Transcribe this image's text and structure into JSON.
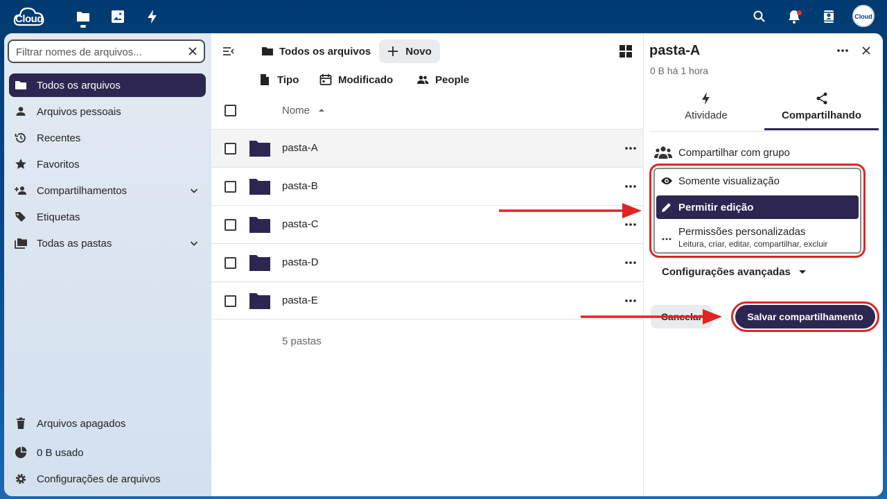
{
  "header": {
    "logo_text": "Cloud",
    "apps": [
      {
        "icon": "folder-icon",
        "name": "files-app"
      },
      {
        "icon": "image-icon",
        "name": "photos-app"
      },
      {
        "icon": "bolt-icon",
        "name": "activity-app"
      }
    ],
    "right_icons": [
      "search-icon",
      "bell-icon",
      "contacts-icon"
    ],
    "avatar_text": "Cloud",
    "brand_color": "#003a70",
    "accent_color": "#2c2651",
    "highlight_color": "#e02424"
  },
  "sidebar": {
    "filter_placeholder": "Filtrar nomes de arquivos...",
    "items": [
      {
        "label": "Todos os arquivos",
        "icon": "folder-icon",
        "active": true
      },
      {
        "label": "Arquivos pessoais",
        "icon": "person-icon"
      },
      {
        "label": "Recentes",
        "icon": "history-icon"
      },
      {
        "label": "Favoritos",
        "icon": "star-icon"
      },
      {
        "label": "Compartilhamentos",
        "icon": "share-person-icon",
        "expandable": true
      },
      {
        "label": "Etiquetas",
        "icon": "tag-icon"
      },
      {
        "label": "Todas as pastas",
        "icon": "folders-icon",
        "expandable": true
      }
    ],
    "bottom": [
      {
        "label": "Arquivos apagados",
        "icon": "trash-icon"
      },
      {
        "label": "0 B usado",
        "icon": "pie-chart-icon"
      },
      {
        "label": "Configurações de arquivos",
        "icon": "gear-icon"
      }
    ]
  },
  "main": {
    "breadcrumb": "Todos os arquivos",
    "new_button": "Novo",
    "filters": [
      {
        "label": "Tipo",
        "icon": "file-icon"
      },
      {
        "label": "Modificado",
        "icon": "calendar-icon"
      },
      {
        "label": "People",
        "icon": "people-icon"
      }
    ],
    "column_name": "Nome",
    "rows": [
      {
        "name": "pasta-A",
        "highlighted": true
      },
      {
        "name": "pasta-B"
      },
      {
        "name": "pasta-C"
      },
      {
        "name": "pasta-D"
      },
      {
        "name": "pasta-E"
      }
    ],
    "footer": "5 pastas"
  },
  "sidebar_right": {
    "title": "pasta-A",
    "subtitle": "0 B há 1 hora",
    "tabs": [
      {
        "label": "Atividade",
        "icon": "bolt-icon"
      },
      {
        "label": "Compartilhando",
        "icon": "share-icon",
        "active": true
      }
    ],
    "share_with": "Compartilhar com grupo",
    "options": [
      {
        "label": "Somente visualização",
        "icon": "eye-icon"
      },
      {
        "label": "Permitir edição",
        "icon": "pencil-icon",
        "selected": true
      },
      {
        "label": "Permissões personalizadas",
        "sub": "Leitura, criar, editar, compartilhar, excluir",
        "icon": "dots-icon"
      }
    ],
    "advanced": "Configurações avançadas",
    "cancel": "Cancelar",
    "save": "Salvar compartilhamento"
  }
}
